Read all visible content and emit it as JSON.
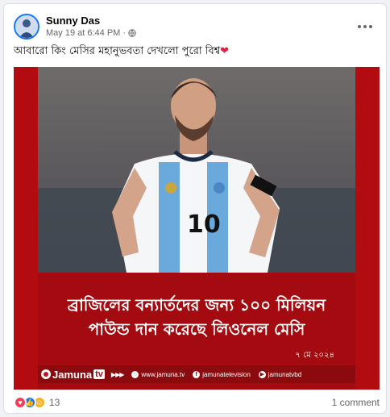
{
  "post": {
    "author": "Sunny Das",
    "date": "May 19 at 6:44 PM",
    "separator": "·",
    "caption": "আবারো কিং মেসির মহানুভবতা দেখলো পুরো বিশ্ব",
    "caption_emoji": "❤",
    "privacy_icon": "globe-icon",
    "more_icon": "more-horizontal-icon"
  },
  "media": {
    "headline_line1": "ব্রাজিলের বন্যার্তদের জন্য ১০০ মিলিয়ন",
    "headline_line2": "পাউন্ড দান করেছে লিওনেল মেসি",
    "date": "৭ মে ২০২৪",
    "brand": "Jamuna",
    "brand_tv": "tv",
    "arrows": "▶▶▶",
    "links": [
      {
        "icon": "globe-icon",
        "text": "www.jamuna.tv"
      },
      {
        "icon": "facebook-icon",
        "text": "jamunatelevision"
      },
      {
        "icon": "youtube-icon",
        "text": "jamunatvbd"
      }
    ],
    "colors": {
      "background": "#b30c10",
      "bar": "#8a0a0d",
      "shirt_blue": "#6aa9dc"
    }
  },
  "footer": {
    "reactions": [
      "love-reaction-icon",
      "like-reaction-icon",
      "care-reaction-icon"
    ],
    "reaction_count": "13",
    "comments": "1 comment"
  }
}
